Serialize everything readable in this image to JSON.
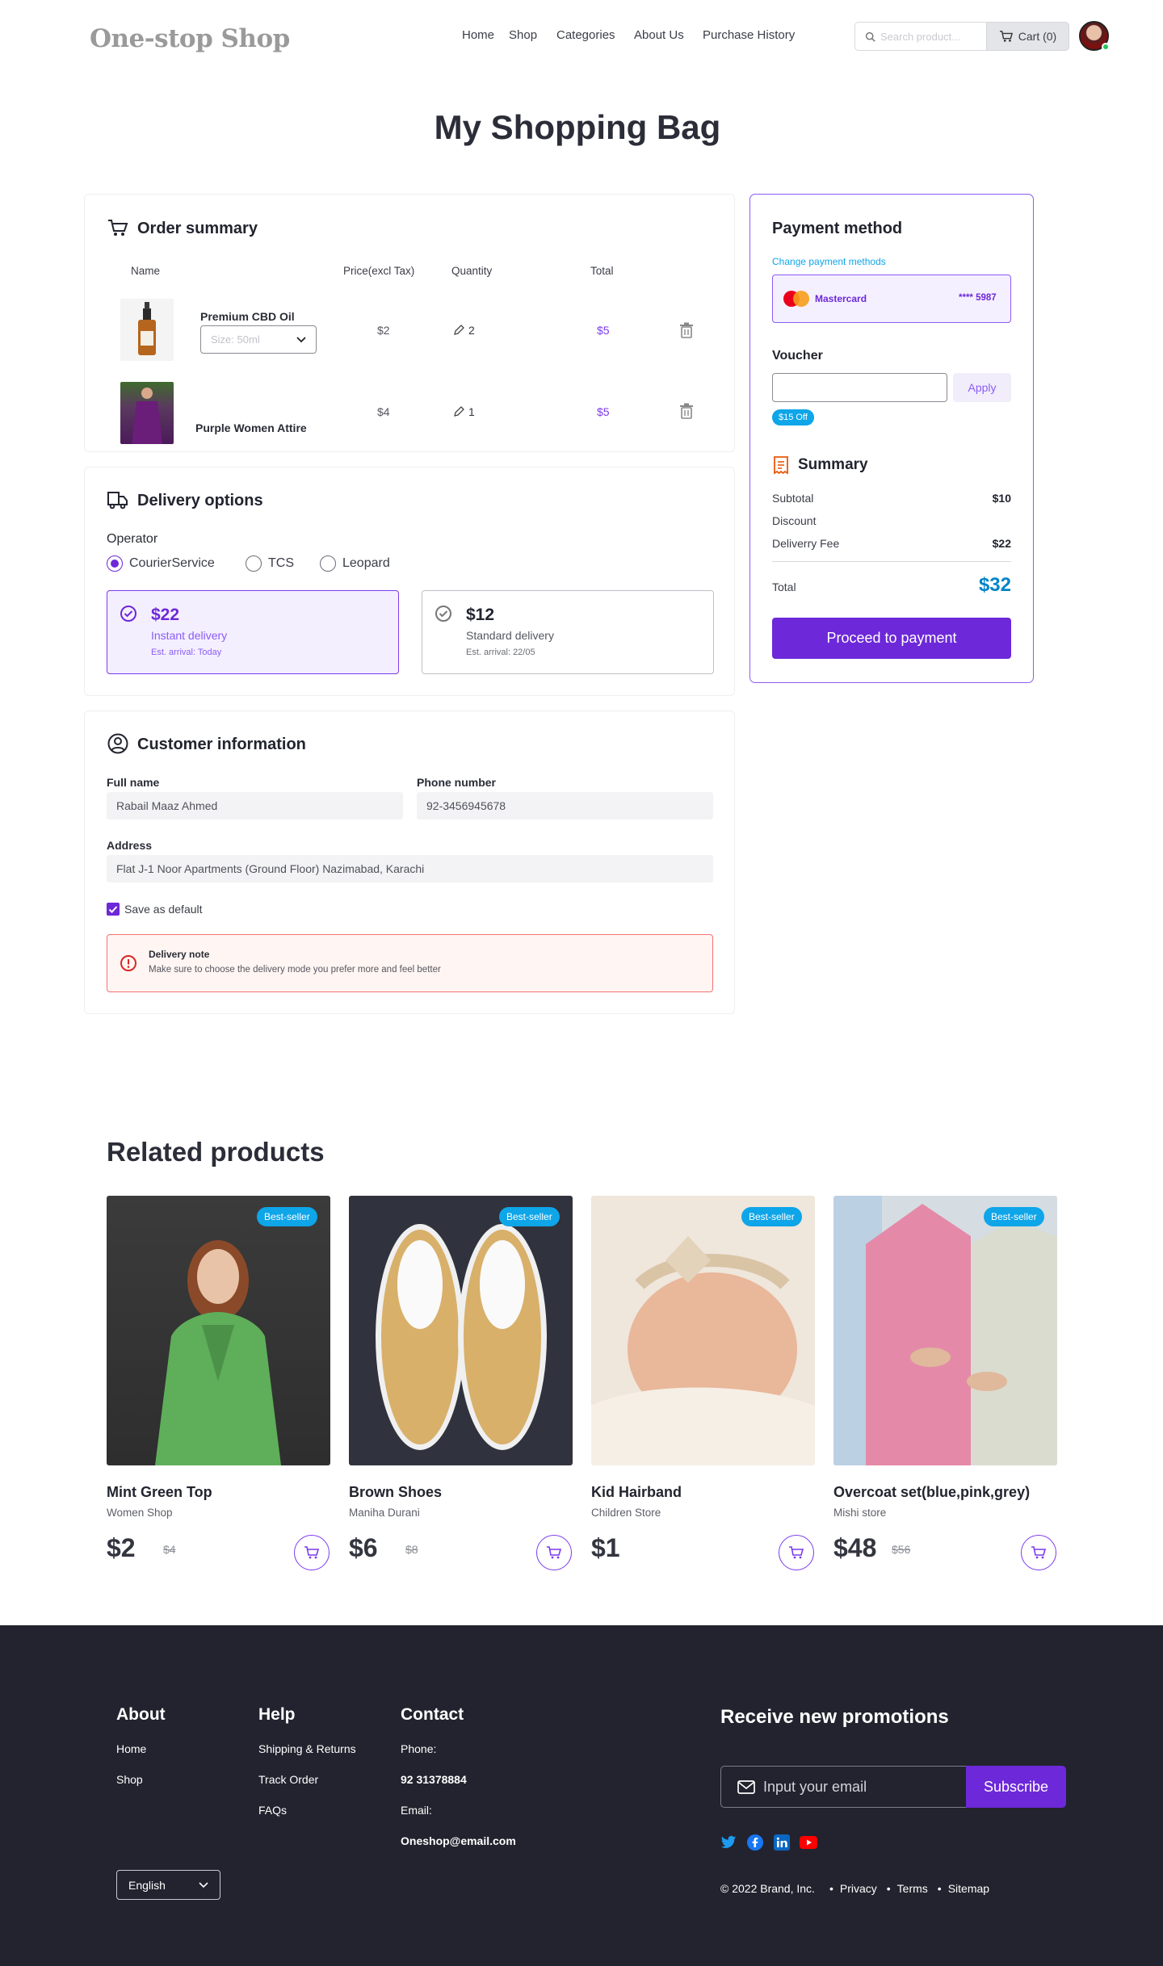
{
  "brand": "One-stop Shop",
  "nav": [
    "Home",
    "Shop",
    "Categories",
    "About Us",
    "Purchase History"
  ],
  "search_placeholder": "Search product...",
  "cart_label": "Cart (0)",
  "page_title": "My Shopping Bag",
  "order": {
    "title": "Order summary",
    "headers": {
      "name": "Name",
      "price": "Price(excl Tax)",
      "quantity": "Quantity",
      "total": "Total"
    },
    "items": [
      {
        "name": "Premium CBD Oil",
        "size": "Size: 50ml",
        "price": "$2",
        "qty": "2",
        "total": "$5"
      },
      {
        "name": "Purple Women Attire",
        "price": "$4",
        "qty": "1",
        "total": "$5"
      }
    ]
  },
  "delivery": {
    "title": "Delivery options",
    "operator_label": "Operator",
    "operators": [
      "CourierService",
      "TCS",
      "Leopard"
    ],
    "selected_operator": "CourierService",
    "options": [
      {
        "price": "$22",
        "name": "Instant delivery",
        "eta": "Est. arrival: Today",
        "selected": true
      },
      {
        "price": "$12",
        "name": "Standard delivery",
        "eta": "Est. arrival: 22/05",
        "selected": false
      }
    ]
  },
  "customer": {
    "title": "Customer information",
    "full_name_label": "Full name",
    "full_name": "Rabail Maaz Ahmed",
    "phone_label": "Phone number",
    "phone": "92-3456945678",
    "address_label": "Address",
    "address": "Flat J-1 Noor Apartments  (Ground Floor) Nazimabad, Karachi",
    "save_default": "Save as default",
    "note_title": "Delivery note",
    "note_text": "Make sure to choose the delivery mode you prefer more and feel better"
  },
  "payment": {
    "title": "Payment method",
    "change_link": "Change payment methods",
    "card_brand": "Mastercard",
    "card_number": "**** 5987",
    "voucher_label": "Voucher",
    "voucher_value": "",
    "apply": "Apply",
    "voucher_tag": "$15 Off",
    "summary_title": "Summary",
    "subtotal_label": "Subtotal",
    "subtotal": "$10",
    "discount_label": "Discount",
    "discount": "",
    "fee_label": "Deliverry Fee",
    "fee": "$22",
    "total_label": "Total",
    "total": "$32",
    "proceed": "Proceed to payment"
  },
  "related": {
    "title": "Related products",
    "badge": "Best-seller",
    "items": [
      {
        "name": "Mint Green Top",
        "shop": "Women Shop",
        "price": "$2",
        "old_price": "$4"
      },
      {
        "name": "Brown Shoes",
        "shop": "Maniha Durani",
        "price": "$6",
        "old_price": "$8"
      },
      {
        "name": "Kid Hairband",
        "shop": "Children Store",
        "price": "$1",
        "old_price": ""
      },
      {
        "name": "Overcoat set(blue,pink,grey)",
        "shop": "Mishi store",
        "price": "$48",
        "old_price": "$56"
      }
    ]
  },
  "footer": {
    "about_title": "About",
    "about_links": [
      "Home",
      "Shop"
    ],
    "help_title": "Help",
    "help_links": [
      "Shipping & Returns",
      "Track Order",
      "FAQs"
    ],
    "contact_title": "Contact",
    "phone_label": "Phone:",
    "phone": "92 31378884",
    "email_label": "Email:",
    "email": "Oneshop@email.com",
    "promo_title": "Receive new promotions",
    "email_placeholder": "Input your email",
    "subscribe": "Subscribe",
    "language": "English",
    "copyright": "© 2022 Brand, Inc.",
    "links": [
      "Privacy",
      "Terms",
      "Sitemap"
    ]
  },
  "colors": {
    "accent": "#6d28d9",
    "badge": "#0ea5e9",
    "footer_bg": "#22232e",
    "total_blue": "#0284c7"
  }
}
